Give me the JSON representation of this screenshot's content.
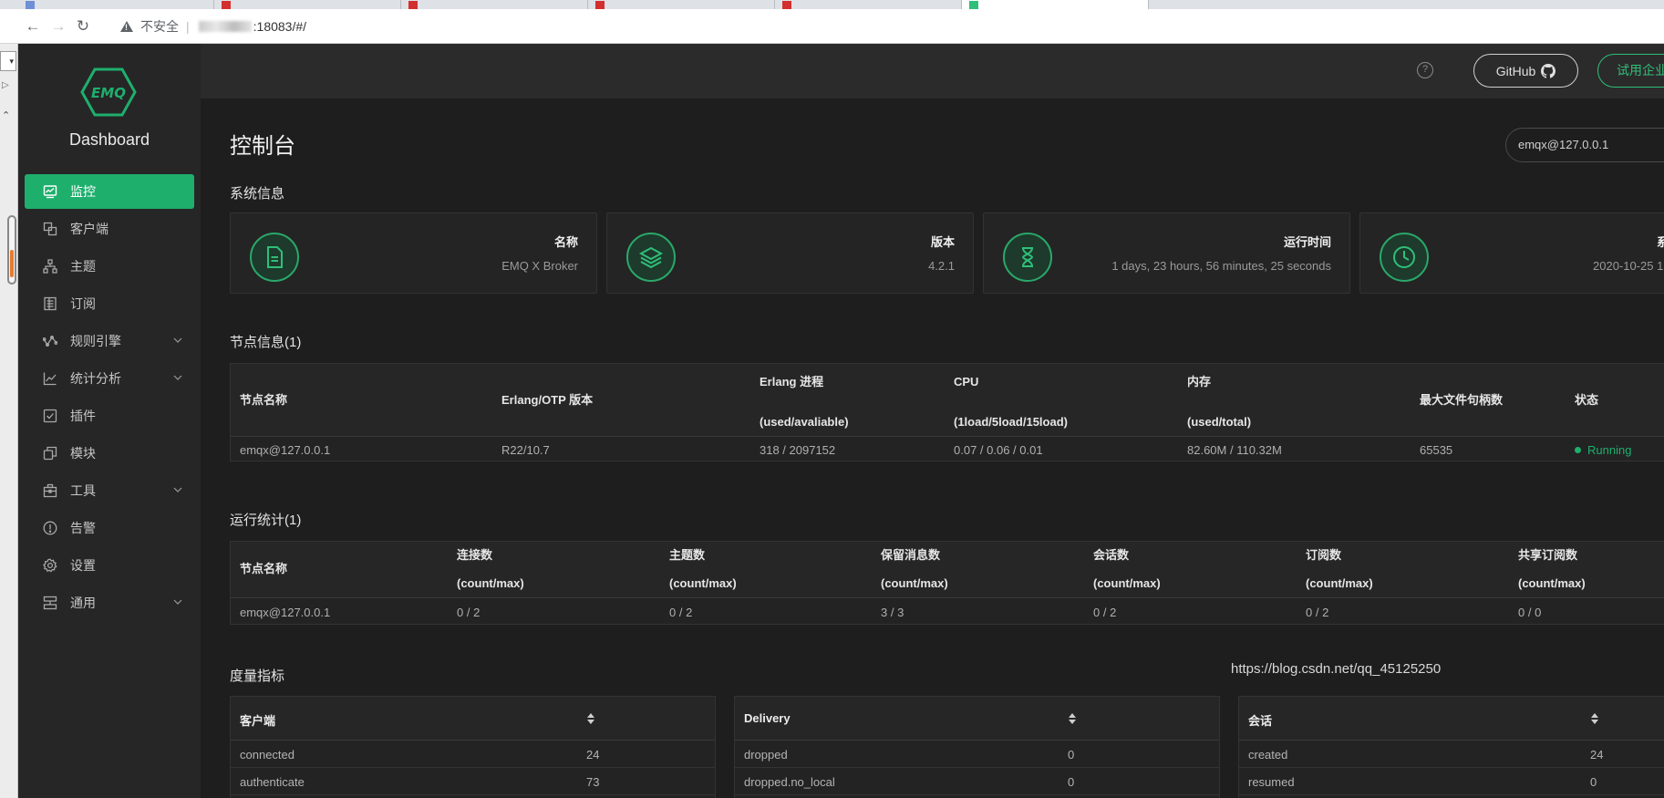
{
  "browser": {
    "insecure_label": "不安全",
    "url_port_path": ":18083/#/"
  },
  "leftstrip": {
    "select_glyph": "▾",
    "play_glyph": "▷",
    "chev_glyph": "⌃"
  },
  "sidebar": {
    "brand_logo_text": "EMQ",
    "brand_title": "Dashboard",
    "items": [
      {
        "label": "监控",
        "icon": "monitor-icon",
        "active": true
      },
      {
        "label": "客户端",
        "icon": "clients-icon"
      },
      {
        "label": "主题",
        "icon": "topics-icon"
      },
      {
        "label": "订阅",
        "icon": "subscriptions-icon"
      },
      {
        "label": "规则引擎",
        "icon": "rule-engine-icon",
        "expandable": true
      },
      {
        "label": "统计分析",
        "icon": "analytics-icon",
        "expandable": true
      },
      {
        "label": "插件",
        "icon": "plugins-icon"
      },
      {
        "label": "模块",
        "icon": "modules-icon"
      },
      {
        "label": "工具",
        "icon": "tools-icon",
        "expandable": true
      },
      {
        "label": "告警",
        "icon": "alarm-icon"
      },
      {
        "label": "设置",
        "icon": "settings-icon"
      },
      {
        "label": "通用",
        "icon": "general-icon",
        "expandable": true
      }
    ]
  },
  "topbar": {
    "help_glyph": "?",
    "github_label": "GitHub",
    "trial_label": "试用企业"
  },
  "page": {
    "title": "控制台",
    "node_select_value": "emqx@127.0.0.1"
  },
  "system_info": {
    "section_title": "系统信息",
    "cards": [
      {
        "label": "名称",
        "value": "EMQ X Broker",
        "icon": "document-icon"
      },
      {
        "label": "版本",
        "value": "4.2.1",
        "icon": "layers-icon"
      },
      {
        "label": "运行时间",
        "value": "1 days, 23 hours, 56 minutes, 25 seconds",
        "icon": "hourglass-icon"
      },
      {
        "label": "系",
        "value": "2020-10-25 1",
        "icon": "clock-icon"
      }
    ]
  },
  "node_info": {
    "section_title": "节点信息(1)",
    "headers": {
      "name": "节点名称",
      "otp": "Erlang/OTP 版本",
      "proc_1": "Erlang 进程",
      "proc_2": "(used/avaliable)",
      "cpu_1": "CPU",
      "cpu_2": "(1load/5load/15load)",
      "mem_1": "内存",
      "mem_2": "(used/total)",
      "max_fds": "最大文件句柄数",
      "status": "状态"
    },
    "row": {
      "name": "emqx@127.0.0.1",
      "otp": "R22/10.7",
      "proc": "318 / 2097152",
      "cpu": "0.07 / 0.06 / 0.01",
      "mem": "82.60M / 110.32M",
      "max_fds": "65535",
      "status": "Running"
    }
  },
  "run_stats": {
    "section_title": "运行统计(1)",
    "headers": [
      "节点名称",
      "连接数",
      "主题数",
      "保留消息数",
      "会话数",
      "订阅数",
      "共享订阅数"
    ],
    "subheader": "(count/max)",
    "row": [
      "emqx@127.0.0.1",
      "0 / 2",
      "0 / 2",
      "3 / 3",
      "0 / 2",
      "0 / 2",
      "0 / 0"
    ]
  },
  "metrics": {
    "section_title": "度量指标",
    "panels": [
      {
        "title": "客户端",
        "rows": [
          {
            "k": "connected",
            "v": "24"
          },
          {
            "k": "authenticate",
            "v": "73"
          }
        ]
      },
      {
        "title": "Delivery",
        "rows": [
          {
            "k": "dropped",
            "v": "0"
          },
          {
            "k": "dropped.no_local",
            "v": "0"
          }
        ]
      },
      {
        "title": "会话",
        "rows": [
          {
            "k": "created",
            "v": "24"
          },
          {
            "k": "resumed",
            "v": "0"
          }
        ]
      }
    ]
  },
  "watermark": "https://blog.csdn.net/qq_45125250",
  "colors": {
    "accent": "#1eaf6d",
    "sidebar_bg": "#262626",
    "main_bg": "#1e1e1e"
  }
}
